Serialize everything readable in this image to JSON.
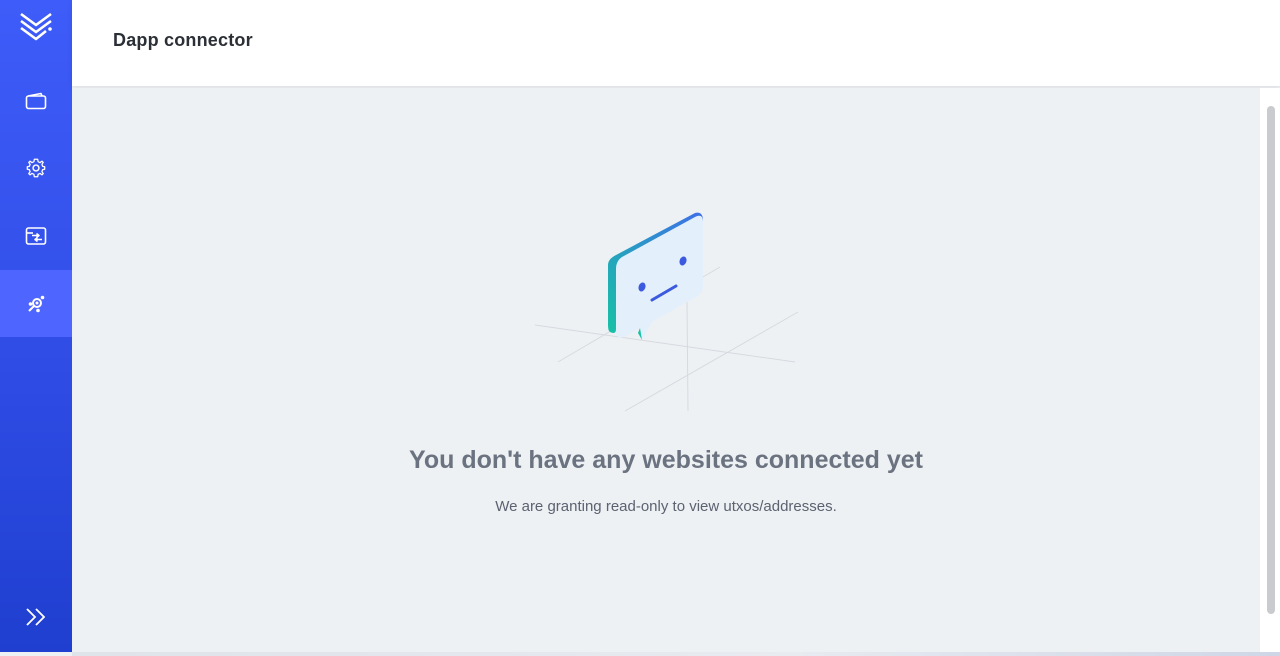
{
  "header": {
    "title": "Dapp connector"
  },
  "sidebar": {
    "items": [
      {
        "icon": "wallet-icon"
      },
      {
        "icon": "gear-icon"
      },
      {
        "icon": "transfer-icon"
      },
      {
        "icon": "dapp-connector-icon",
        "active": true
      }
    ],
    "expand_icon": "double-chevron-right-icon"
  },
  "empty_state": {
    "title": "You don't have any websites connected yet",
    "subtitle": "We are granting read-only to view utxos/addresses."
  },
  "colors": {
    "sidebar_top": "#3e5cf9",
    "sidebar_bottom": "#1f3fd0",
    "active_item": "#4e65ff",
    "accent_teal": "#17c1a6"
  }
}
